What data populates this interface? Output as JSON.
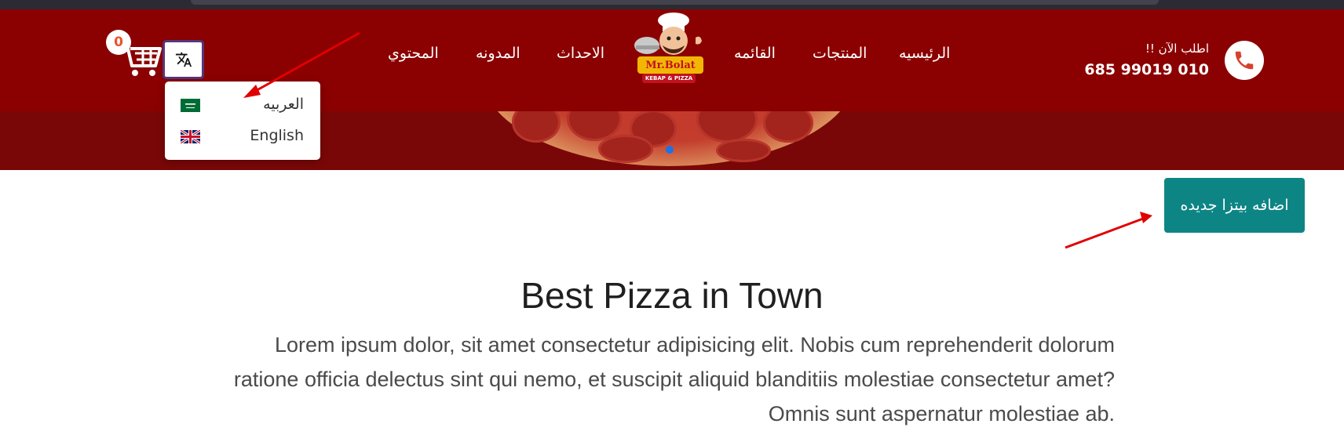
{
  "header": {
    "phone_cta": "اطلب الآن !!",
    "phone_number": "685 99019 010",
    "logo_text": "Mr.Bolat",
    "logo_subtext": "KEBAP & PIZZA",
    "nav": [
      {
        "label": "الرئيسيه"
      },
      {
        "label": "المنتجات"
      },
      {
        "label": "القائمه"
      },
      {
        "label": "الاحداث"
      },
      {
        "label": "المدونه"
      },
      {
        "label": "المحتوي"
      }
    ],
    "cart_count": "0"
  },
  "language_menu": {
    "items": [
      {
        "label": "العربيه",
        "flag": "saudi-flag-icon"
      },
      {
        "label": "English",
        "flag": "uk-flag-icon"
      }
    ]
  },
  "actions": {
    "add_pizza_label": "اضافه بيتزا جديده"
  },
  "content": {
    "title": "Best Pizza in Town",
    "body": "Lorem ipsum dolor, sit amet consectetur adipisicing elit. Nobis cum reprehenderit dolorum ratione officia delectus sint qui nemo, et suscipit aliquid blanditiis molestiae consectetur amet? Omnis sunt aspernatur molestiae ab."
  },
  "colors": {
    "header_bg": "#8b0000",
    "button_teal": "#0e8585",
    "annotation_arrow": "#e00000"
  }
}
